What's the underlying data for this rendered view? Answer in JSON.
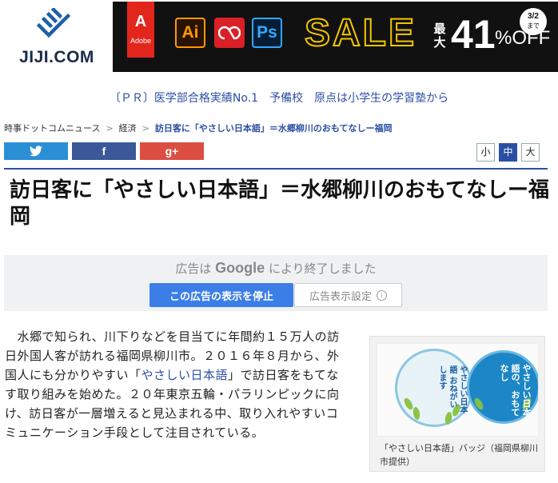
{
  "header": {
    "logo_text": "JIJI.COM",
    "banner": {
      "adobe_label": "Adobe",
      "apps": [
        "Ai",
        "Ps"
      ],
      "sale_text": "SALE",
      "max_label": "最大",
      "discount": "41",
      "off_label": "%OFF",
      "date": "3/2",
      "until": "まで"
    }
  },
  "pr_link": "〔ＰＲ〕医学部合格実績No.1　予備校　原点は小学生の学習塾から",
  "breadcrumb": {
    "items": [
      "時事ドットコムニュース",
      "経済"
    ],
    "current": "訪日客に「やさしい日本語」＝水郷柳川のおもてなしー福岡",
    "separator": ">"
  },
  "share": {
    "twitter": "🐦",
    "facebook": "f",
    "google": "g+"
  },
  "font_size": {
    "small": "小",
    "medium": "中",
    "large": "大"
  },
  "article": {
    "title": "訪日客に「やさしい日本語」＝水郷柳川のおもてなしー福岡",
    "body_part1": "水郷で知られ、川下りなどを目当てに年間約１５万人の訪日外国人客が訪れる福岡県柳川市。２０１６年８月から、外国人にも分かりやすい「",
    "body_link": "やさしい日本語",
    "body_part2": "」で訪日客をもてなす取り組みを始めた。２０年東京五輪・パラリンピックに向け、訪日客が一層増えると見込まれる中、取り入れやすいコミュニケーション手段として注目されている。",
    "photo_caption": "「やさしい日本語」バッジ（福岡県柳川市提供）",
    "badge1_text": "やさしい日本語 おねがいします",
    "badge2_text": "やさしい日本語の、おもてなし"
  },
  "ad": {
    "closed_prefix": "広告は",
    "closed_brand": "Google",
    "closed_suffix": "により終了しました",
    "stop_button": "この広告の表示を停止",
    "settings_button": "広告表示設定",
    "info_symbol": "i"
  },
  "colors": {
    "accent": "#2b4fa4",
    "twitter": "#2b8fd6",
    "facebook": "#3b5998",
    "google": "#dc4e41",
    "ad_button": "#3b7ee8"
  }
}
